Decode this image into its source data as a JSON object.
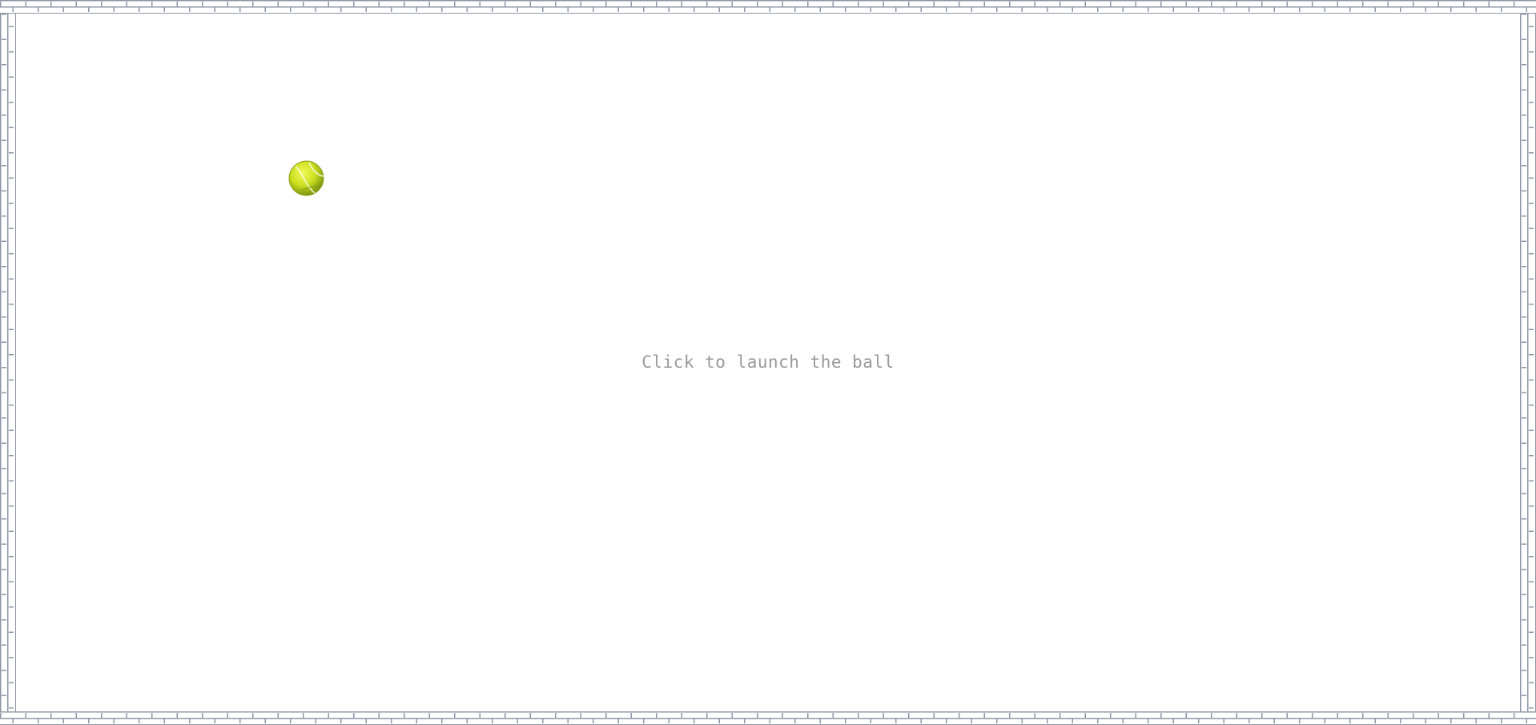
{
  "game": {
    "hint_text": "Click to launch the ball",
    "ball_icon": "tennis-ball-icon",
    "wall_pattern": "brick-wall",
    "colors": {
      "background": "#ffffff",
      "wall": "#8f96a6",
      "hint_text": "#9a9a9a",
      "ball": "#c8dd1e"
    }
  }
}
